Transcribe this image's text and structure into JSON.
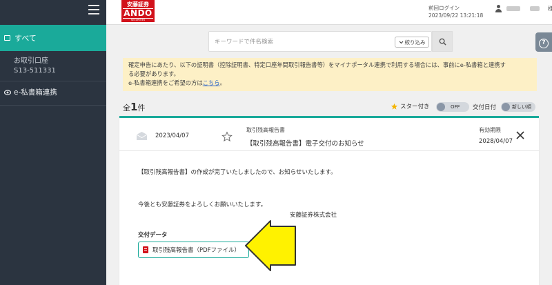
{
  "header": {
    "logo_jp": "安藤証券",
    "logo_en": "ANDO",
    "logo_sub": "SECURITIES",
    "last_login_label": "前回ログイン",
    "last_login_time": "2023/09/22 13:21:18",
    "user_suffix": "様"
  },
  "sidebar": {
    "all_label": "すべて",
    "account_label": "お取引口座",
    "account_number": "S13-511331",
    "ebox_label": "e-私書箱連携"
  },
  "search": {
    "placeholder": "キーワードで件名検索",
    "filter_label": "絞り込み"
  },
  "notice": {
    "line1": "確定申告にあたり、以下の証明書（控除証明書、特定口座年間取引報告書等）をマイナポータル連携で利用する場合には、事前にe-私書箱と連携す",
    "line2": "る必要があります。",
    "line3_pre": "e-私書箱連携をご希望の方は",
    "line3_link": "こちら",
    "line3_post": "。"
  },
  "list": {
    "count_prefix": "全",
    "count": "1",
    "count_suffix": "件",
    "star_filter_label": "スター付き",
    "star_toggle_state": "OFF",
    "date_label": "交付日付",
    "date_toggle_state": "新しい順"
  },
  "message": {
    "date": "2023/04/07",
    "category": "取引残高報告書",
    "subject": "【取引残高報告書】電子交付のお知らせ",
    "expiry_label": "有効期限",
    "expiry_date": "2028/04/07",
    "body_line1": "【取引残高報告書】の作成が完了いたしましたので、お知らせいたします。",
    "body_line2": "今後とも安藤証券をよろしくお願いいたします。",
    "body_line3": "安藤証券株式会社",
    "attachment_label": "交付データ",
    "attachment_file": "取引残高報告書（PDFファイル）"
  },
  "colors": {
    "sidebar_bg": "#2b3440",
    "accent_teal": "#1aaa9a",
    "brand_red": "#d2121b",
    "notice_bg": "#fdf0c6",
    "arrow_yellow": "#fff200"
  },
  "icons": [
    "menu-icon",
    "folder-icon",
    "eye-icon",
    "user-icon",
    "help-icon",
    "chevron-down-icon",
    "search-icon",
    "star-icon",
    "mail-icon",
    "close-icon",
    "pdf-icon",
    "arrow-annotation"
  ]
}
